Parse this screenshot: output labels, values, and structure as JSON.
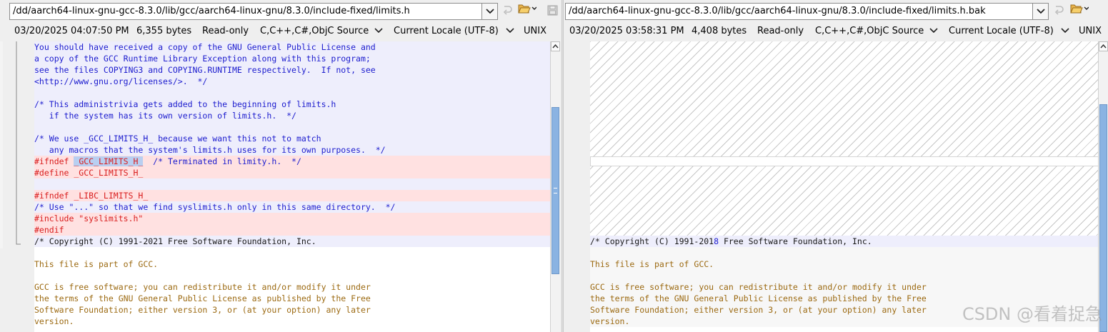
{
  "left": {
    "path": "/dd/aarch64-linux-gnu-gcc-8.3.0/lib/gcc/aarch64-linux-gnu/8.3.0/include-fixed/limits.h",
    "status": {
      "datetime": "03/20/2025 04:07:50 PM",
      "size": "6,355 bytes",
      "mode": "Read-only",
      "syntax": "C,C++,C#,ObjC Source",
      "encoding": "Current Locale (UTF-8)",
      "line_ending": "UNIX"
    },
    "lines": [
      {
        "bg": "blue",
        "parts": [
          {
            "t": "You should have received a copy of the GNU General Public License and",
            "c": "blue"
          }
        ]
      },
      {
        "bg": "blue",
        "parts": [
          {
            "t": "a copy of the GCC Runtime Library Exception along with this program;",
            "c": "blue"
          }
        ]
      },
      {
        "bg": "blue",
        "parts": [
          {
            "t": "see the files COPYING3 and COPYING.RUNTIME respectively.  If not, see",
            "c": "blue"
          }
        ]
      },
      {
        "bg": "blue",
        "parts": [
          {
            "t": "<http://www.gnu.org/licenses/>.  */",
            "c": "blue"
          }
        ]
      },
      {
        "bg": "blue",
        "parts": [
          {
            "t": "",
            "c": "blue"
          }
        ]
      },
      {
        "bg": "blue",
        "parts": [
          {
            "t": "/* This administrivia gets added to the beginning of limits.h",
            "c": "blue"
          }
        ]
      },
      {
        "bg": "blue",
        "parts": [
          {
            "t": "   if the system has its own version of limits.h.  */",
            "c": "blue"
          }
        ]
      },
      {
        "bg": "blue",
        "parts": [
          {
            "t": "",
            "c": "blue"
          }
        ]
      },
      {
        "bg": "blue",
        "parts": [
          {
            "t": "/* We use _GCC_LIMITS_H_ because we want this not to match",
            "c": "blue"
          }
        ]
      },
      {
        "bg": "blue",
        "parts": [
          {
            "t": "   any macros that the system's limits.h uses for its own purposes.  */",
            "c": "blue"
          }
        ]
      },
      {
        "bg": "red",
        "parts": [
          {
            "t": "#ifndef ",
            "c": "red"
          },
          {
            "t": "_GCC_LIMITS_H_",
            "c": "red",
            "sel": true
          },
          {
            "t": "  /* Terminated in limity.h.  */",
            "c": "blue"
          }
        ]
      },
      {
        "bg": "red",
        "parts": [
          {
            "t": "#define _GCC_LIMITS_H_",
            "c": "red"
          }
        ]
      },
      {
        "bg": "blue",
        "parts": [
          {
            "t": "",
            "c": "blue"
          }
        ]
      },
      {
        "bg": "red",
        "parts": [
          {
            "t": "#ifndef _LIBC_LIMITS_H_",
            "c": "red"
          }
        ]
      },
      {
        "bg": "blue",
        "parts": [
          {
            "t": "/* Use \"...\" so that we find syslimits.h only in this same directory.  */",
            "c": "blue"
          }
        ]
      },
      {
        "bg": "red",
        "parts": [
          {
            "t": "#include \"syslimits.h\"",
            "c": "red"
          }
        ]
      },
      {
        "bg": "red",
        "parts": [
          {
            "t": "#endif",
            "c": "red"
          }
        ]
      },
      {
        "bg": "blue",
        "parts": [
          {
            "t": "/* Copyright (C) 1991-2021 Free Software Foundation, Inc.",
            "c": "dark"
          }
        ]
      },
      {
        "bg": "white",
        "parts": [
          {
            "t": "",
            "c": "brown"
          }
        ]
      },
      {
        "bg": "white",
        "parts": [
          {
            "t": "This file is part of GCC.",
            "c": "brown"
          }
        ]
      },
      {
        "bg": "white",
        "parts": [
          {
            "t": "",
            "c": "brown"
          }
        ]
      },
      {
        "bg": "white",
        "parts": [
          {
            "t": "GCC is free software; you can redistribute it and/or modify it under",
            "c": "brown"
          }
        ]
      },
      {
        "bg": "white",
        "parts": [
          {
            "t": "the terms of the GNU General Public License as published by the Free",
            "c": "brown"
          }
        ]
      },
      {
        "bg": "white",
        "parts": [
          {
            "t": "Software Foundation; either version 3, or (at your option) any later",
            "c": "brown"
          }
        ]
      },
      {
        "bg": "white",
        "parts": [
          {
            "t": "version.",
            "c": "brown"
          }
        ]
      }
    ]
  },
  "right": {
    "path": "/dd/aarch64-linux-gnu-gcc-8.3.0/lib/gcc/aarch64-linux-gnu/8.3.0/include-fixed/limits.h.bak",
    "status": {
      "datetime": "03/20/2025 03:58:31 PM",
      "size": "4,408 bytes",
      "mode": "Read-only",
      "syntax": "C,C++,C#,ObjC Source",
      "encoding": "Current Locale (UTF-8)",
      "line_ending": "UNIX"
    },
    "lines": [
      {
        "bg": "blue",
        "parts": [
          {
            "t": "/* Copyright (C) 1991-201",
            "c": "dark"
          },
          {
            "t": "8",
            "c": "blue"
          },
          {
            "t": " Free Software Foundation, Inc.",
            "c": "dark"
          }
        ]
      },
      {
        "bg": "lightgrey",
        "parts": [
          {
            "t": "",
            "c": "brown"
          }
        ]
      },
      {
        "bg": "lightgrey",
        "parts": [
          {
            "t": "This file is part of GCC.",
            "c": "brown"
          }
        ]
      },
      {
        "bg": "lightgrey",
        "parts": [
          {
            "t": "",
            "c": "brown"
          }
        ]
      },
      {
        "bg": "lightgrey",
        "parts": [
          {
            "t": "GCC is free software; you can redistribute it and/or modify it under",
            "c": "brown"
          }
        ]
      },
      {
        "bg": "lightgrey",
        "parts": [
          {
            "t": "the terms of the GNU General Public License as published by the Free",
            "c": "brown"
          }
        ]
      },
      {
        "bg": "lightgrey",
        "parts": [
          {
            "t": "Software Foundation; either version 3, or (at your option) any later",
            "c": "brown"
          }
        ]
      },
      {
        "bg": "lightgrey",
        "parts": [
          {
            "t": "version.",
            "c": "brown"
          }
        ]
      }
    ]
  },
  "icons": {
    "combo": "chevron-down-icon",
    "next_diff": "next-difference-icon",
    "open_folder": "open-folder-icon",
    "save": "save-icon",
    "scroll_up": "scroll-up-arrow-icon",
    "scroll_grip": "scroll-grip-icon"
  },
  "colors": {
    "diff_changed_bg": "#eeeefc",
    "diff_removed_bg": "#ffe1e1",
    "text_blue": "#1c1cce",
    "text_red": "#d91e1e",
    "text_brown": "#9c6a12",
    "scroll_thumb": "#8ab3e2"
  },
  "watermark": "CSDN @看着捉急"
}
